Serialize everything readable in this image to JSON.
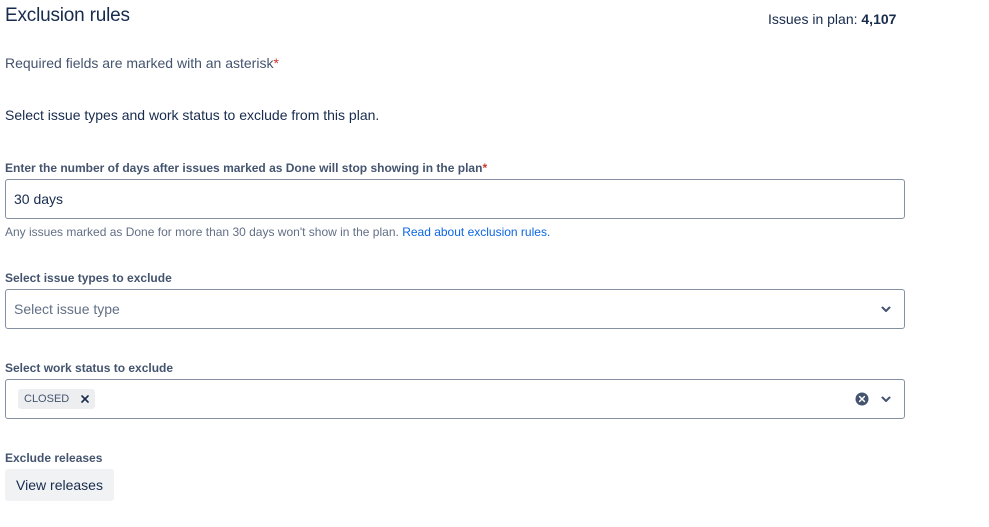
{
  "header": {
    "title": "Exclusion rules",
    "issues_label": "Issues in plan:",
    "issues_count": "4,107"
  },
  "form": {
    "required_note": "Required fields are marked with an asterisk",
    "required_marker": "*",
    "intro": "Select issue types and work status to exclude from this plan.",
    "days_field": {
      "label": "Enter the number of days after issues marked as Done will stop showing in the plan",
      "value": "30 days",
      "helper_text": "Any issues marked as Done for more than 30 days won't show in the plan.",
      "helper_link": "Read about exclusion rules."
    },
    "issue_types_field": {
      "label": "Select issue types to exclude",
      "placeholder": "Select issue type"
    },
    "work_status_field": {
      "label": "Select work status to exclude",
      "selected_tags": [
        "CLOSED"
      ]
    },
    "releases": {
      "label": "Exclude releases",
      "button_label": "View releases"
    }
  },
  "icons": {
    "dropdown": "chevron-down-icon",
    "tag_remove": "close-icon",
    "clear": "clear-circle-icon"
  },
  "colors": {
    "text": "#172B4D",
    "subtle_text": "#44546F",
    "required": "#C9372C",
    "link": "#0C66E4",
    "input_border": "#8590A2",
    "tag_bg": "#EDEEF0",
    "button_bg": "#F1F2F4"
  }
}
